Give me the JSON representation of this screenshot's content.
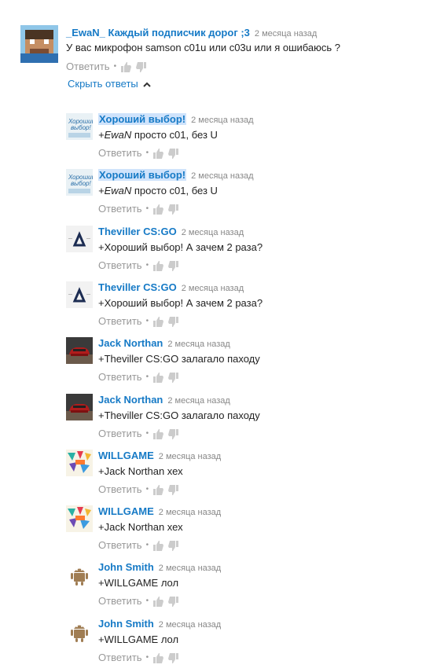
{
  "colors": {
    "link": "#167ac6",
    "time": "#888888",
    "action": "#999999",
    "highlight": "#cfe3fb"
  },
  "labels": {
    "reply": "Ответить",
    "dot": "•"
  },
  "top": {
    "author": "_EwaN_ Каждый подписчик дорог ;3",
    "time": "2 месяца назад",
    "text": "У вас микрофон samson c01u  или c03u или я ошибаюсь ?",
    "avatar": "minecraft-avatar"
  },
  "toggle_label": "Скрыть ответы",
  "replies": [
    {
      "author": "Хороший выбор!",
      "time": "2 месяца назад",
      "mention": "+EwaN",
      "text": " просто c01, без U",
      "avatar": "thumbnail-avatar"
    },
    {
      "author": "Хороший выбор!",
      "time": "2 месяца назад",
      "mention": "+EwaN",
      "text": " просто c01, без U",
      "avatar": "thumbnail-avatar"
    },
    {
      "author": "Theviller CS:GO",
      "time": "2 месяца назад",
      "mention": "",
      "text": "+Хороший выбор! А зачем 2 раза?",
      "avatar": "triangle-logo-avatar"
    },
    {
      "author": "Theviller CS:GO",
      "time": "2 месяца назад",
      "mention": "",
      "text": "+Хороший выбор! А зачем 2 раза?",
      "avatar": "triangle-logo-avatar"
    },
    {
      "author": "Jack Northan",
      "time": "2 месяца назад",
      "mention": "",
      "text": "+Theviller CS:GO залагало паходу",
      "avatar": "car-avatar"
    },
    {
      "author": "Jack Northan",
      "time": "2 месяца назад",
      "mention": "",
      "text": "+Theviller CS:GO залагало паходу",
      "avatar": "car-avatar"
    },
    {
      "author": "WILLGAME",
      "time": "2 месяца назад",
      "mention": "",
      "text": "+Jack Northan хех",
      "avatar": "colorful-logo-avatar"
    },
    {
      "author": "WILLGAME",
      "time": "2 месяца назад",
      "mention": "",
      "text": "+Jack Northan хех",
      "avatar": "colorful-logo-avatar"
    },
    {
      "author": "John Smith",
      "time": "2 месяца назад",
      "mention": "",
      "text": "+WILLGAME лол",
      "avatar": "android-avatar"
    },
    {
      "author": "John Smith",
      "time": "2 месяца назад",
      "mention": "",
      "text": "+WILLGAME лол",
      "avatar": "android-avatar"
    }
  ]
}
